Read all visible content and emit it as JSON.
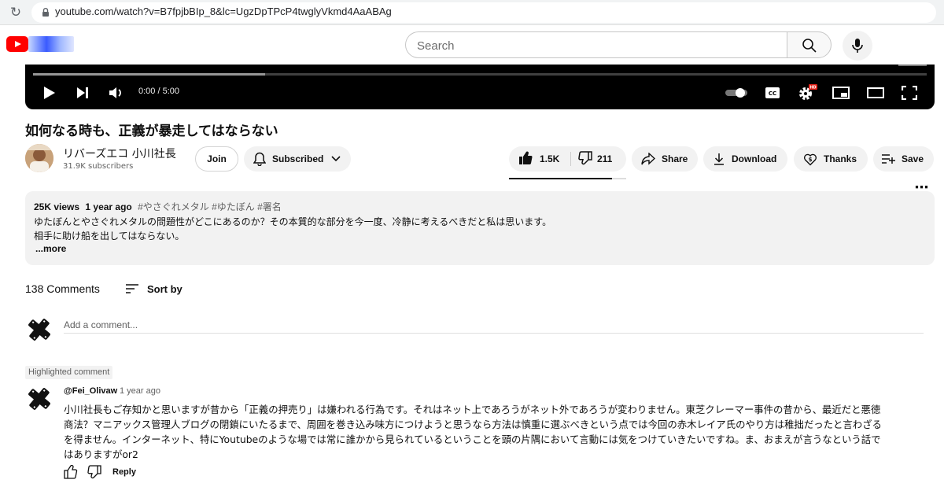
{
  "browser": {
    "url": "youtube.com/watch?v=B7fpjbBIp_8&lc=UgzDpTPcP4twglyVkmd4AaABAg"
  },
  "header": {
    "search_placeholder": "Search"
  },
  "player": {
    "time": "0:00 / 5:00",
    "progress_fraction": 0.0,
    "buffered_fraction": 0.26
  },
  "video": {
    "title": "如何なる時も、正義が暴走してはならない",
    "channel_name": "リバーズエコ 小川社長",
    "subscribers": "31.9K subscribers",
    "join_label": "Join",
    "subscribed_label": "Subscribed",
    "likes": "1.5K",
    "dislikes": "211",
    "like_ratio": 0.88,
    "share_label": "Share",
    "download_label": "Download",
    "thanks_label": "Thanks",
    "save_label": "Save"
  },
  "description": {
    "views": "25K views",
    "age": "1 year ago",
    "tags": "#やさぐれメタル #ゆたぼん #署名",
    "lines": [
      "ゆたぼんとやさぐれメタルの問題性がどこにあるのか？その本質的な部分を今一度、冷静に考えるべきだと私は思います。",
      "相手に助け船を出してはならない。"
    ],
    "more_label": "...more"
  },
  "comments": {
    "count_label": "138 Comments",
    "sort_label": "Sort by",
    "add_placeholder": "Add a comment...",
    "highlight_label": "Highlighted comment",
    "items": [
      {
        "author": "@Fei_Olivaw",
        "time": "1 year ago",
        "lines": [
          "小川社長もご存知かと思いますが昔から「正義の押売り」は嫌われる行為です。それはネット上であろうがネット外であろうが変わりません。東芝クレーマー事件の昔から、最近だと悪徳",
          "商法？マニアックス管理人ブログの閉鎖にいたるまで、周囲を巻き込み味方につけようと思うなら方法は慎重に選ぶべきという点では今回の赤木レイア氏のやり方は稚拙だったと言わざる",
          "を得ません。インターネット、特にYoutubeのような場では常に誰かから見られているということを頭の片隅において言動には気をつけていきたいですね。ま、おまえが言うなという話で",
          "はありますがor2"
        ],
        "reply_label": "Reply"
      }
    ]
  }
}
